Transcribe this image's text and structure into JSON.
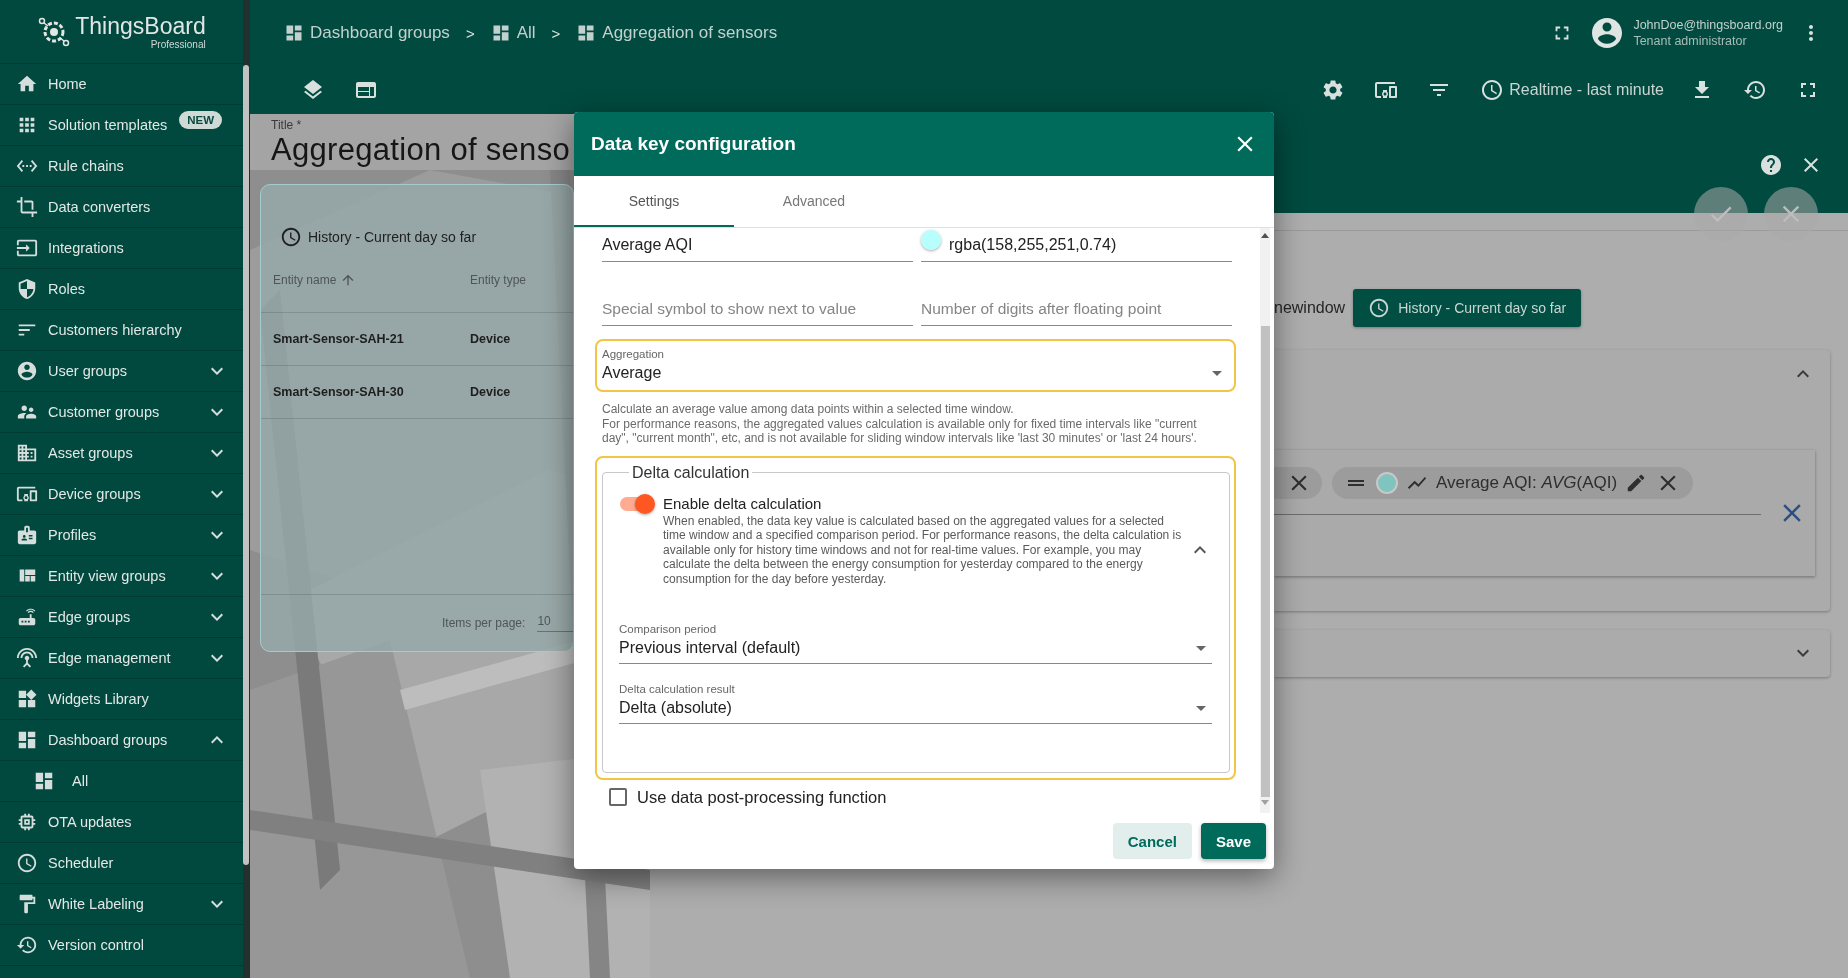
{
  "sidebar": {
    "logo": {
      "name": "ThingsBoard",
      "edition": "Professional"
    },
    "items": [
      {
        "label": "Home",
        "kind": "link"
      },
      {
        "label": "Solution templates",
        "kind": "link",
        "badge": "NEW"
      },
      {
        "label": "Rule chains",
        "kind": "link"
      },
      {
        "label": "Data converters",
        "kind": "link"
      },
      {
        "label": "Integrations",
        "kind": "link"
      },
      {
        "label": "Roles",
        "kind": "link"
      },
      {
        "label": "Customers hierarchy",
        "kind": "link"
      },
      {
        "label": "User groups",
        "kind": "group",
        "expanded": false
      },
      {
        "label": "Customer groups",
        "kind": "group",
        "expanded": false
      },
      {
        "label": "Asset groups",
        "kind": "group",
        "expanded": false
      },
      {
        "label": "Device groups",
        "kind": "group",
        "expanded": false
      },
      {
        "label": "Profiles",
        "kind": "group",
        "expanded": false
      },
      {
        "label": "Entity view groups",
        "kind": "group",
        "expanded": false
      },
      {
        "label": "Edge groups",
        "kind": "group",
        "expanded": false
      },
      {
        "label": "Edge management",
        "kind": "group",
        "expanded": false
      },
      {
        "label": "Widgets Library",
        "kind": "link"
      },
      {
        "label": "Dashboard groups",
        "kind": "group",
        "expanded": true,
        "children": [
          {
            "label": "All"
          }
        ]
      },
      {
        "label": "OTA updates",
        "kind": "link"
      },
      {
        "label": "Scheduler",
        "kind": "link"
      },
      {
        "label": "White Labeling",
        "kind": "group",
        "expanded": false
      },
      {
        "label": "Version control",
        "kind": "link"
      }
    ]
  },
  "topbar": {
    "breadcrumbs": [
      {
        "label": "Dashboard groups",
        "separator": ">"
      },
      {
        "label": "All",
        "separator": ">"
      },
      {
        "label": "Aggregation of sensors"
      }
    ],
    "user": {
      "email": "JohnDoe@thingsboard.org",
      "role": "Tenant administrator"
    },
    "timewindow": "Realtime - last minute"
  },
  "dashboard": {
    "title_label": "Title *",
    "title": "Aggregation of senso",
    "widget": {
      "timewindow": "History - Current day so far",
      "columns": [
        {
          "label": "Entity name",
          "sorted": true
        },
        {
          "label": "Entity type",
          "sorted": false
        }
      ],
      "rows": [
        [
          "Smart-Sensor-SAH-21",
          "Device"
        ],
        [
          "Smart-Sensor-SAH-30",
          "Device"
        ]
      ],
      "items_per_page_label": "Items per page:",
      "items_per_page": "10"
    }
  },
  "edit_panel": {
    "timewindow_label": "newindow",
    "timewindow": "History - Current day so far",
    "sections": [
      {
        "expanded": true
      },
      {
        "expanded": false
      }
    ],
    "datakeys": [
      {
        "kind": "cut"
      },
      {
        "kind": "key",
        "label": "Average AQI: *AVG*(AQI)",
        "color": "#80c4c0"
      }
    ]
  },
  "dialog": {
    "title": "Data key configuration",
    "tabs": [
      {
        "label": "Settings",
        "selected": true
      },
      {
        "label": "Advanced",
        "selected": false
      }
    ],
    "label_value": "Average AQI",
    "color_value": "rgba(158,255,251,0.74)",
    "placeholders": [
      "Special symbol to show next to value",
      "Number of digits after floating point"
    ],
    "aggregation": {
      "label": "Aggregation",
      "value": "Average",
      "highlighted": true
    },
    "hints": [
      "Calculate an average value among data points within a selected time window.",
      "For performance reasons, the aggregated values calculation is available only for fixed time intervals like \"current day\", \"current month\", etc, and is not available for sliding window intervals like 'last 30 minutes' or 'last 24 hours'."
    ],
    "delta": {
      "legend": "Delta calculation",
      "highlighted": true,
      "toggle": {
        "label": "Enable delta calculation",
        "on": true,
        "expanded": true,
        "description": "When enabled, the data key value is calculated based on the aggregated values for a selected time window and a specified comparison period. For performance reasons, the delta calculation is available only for history time windows and not for real-time values. For example, you may calculate the delta between the energy consumption for yesterday compared to the energy consumption for the day before yesterday."
      },
      "selects": [
        {
          "label": "Comparison period",
          "value": "Previous interval (default)"
        },
        {
          "label": "Delta calculation result",
          "value": "Delta (absolute)"
        }
      ]
    },
    "checkbox": {
      "label": "Use data post-processing function",
      "checked": false
    },
    "buttons": [
      {
        "label": "Cancel",
        "kind": "secondary"
      },
      {
        "label": "Save",
        "kind": "primary"
      }
    ]
  }
}
